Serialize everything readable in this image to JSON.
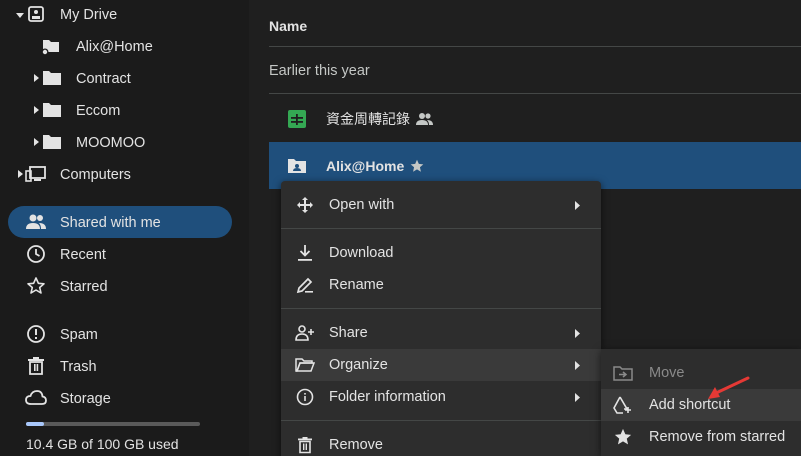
{
  "sidebar": {
    "my_drive": "My Drive",
    "folders": [
      "Alix@Home",
      "Contract",
      "Eccom",
      "MOOMOO"
    ],
    "computers": "Computers",
    "shared_with_me": "Shared with me",
    "recent": "Recent",
    "starred": "Starred",
    "spam": "Spam",
    "trash": "Trash",
    "storage": "Storage",
    "storage_used_text": "10.4 GB of 100 GB used",
    "storage_used_fraction": 0.104
  },
  "main": {
    "column_name": "Name",
    "section_label": "Earlier this year",
    "rows": [
      {
        "name": "資金周轉記錄",
        "icon": "sheets-icon",
        "shared": true
      },
      {
        "name": "Alix@Home",
        "icon": "shared-folder-icon",
        "starred": true
      }
    ]
  },
  "context_menu": {
    "open_with": "Open with",
    "download": "Download",
    "rename": "Rename",
    "share": "Share",
    "organize": "Organize",
    "folder_information": "Folder information",
    "remove": "Remove"
  },
  "submenu": {
    "move": "Move",
    "add_shortcut": "Add shortcut",
    "remove_from_starred": "Remove from starred"
  },
  "colors": {
    "selected": "#1f4f7c",
    "sheets_green": "#34a853",
    "annotation_red": "#e53935"
  }
}
